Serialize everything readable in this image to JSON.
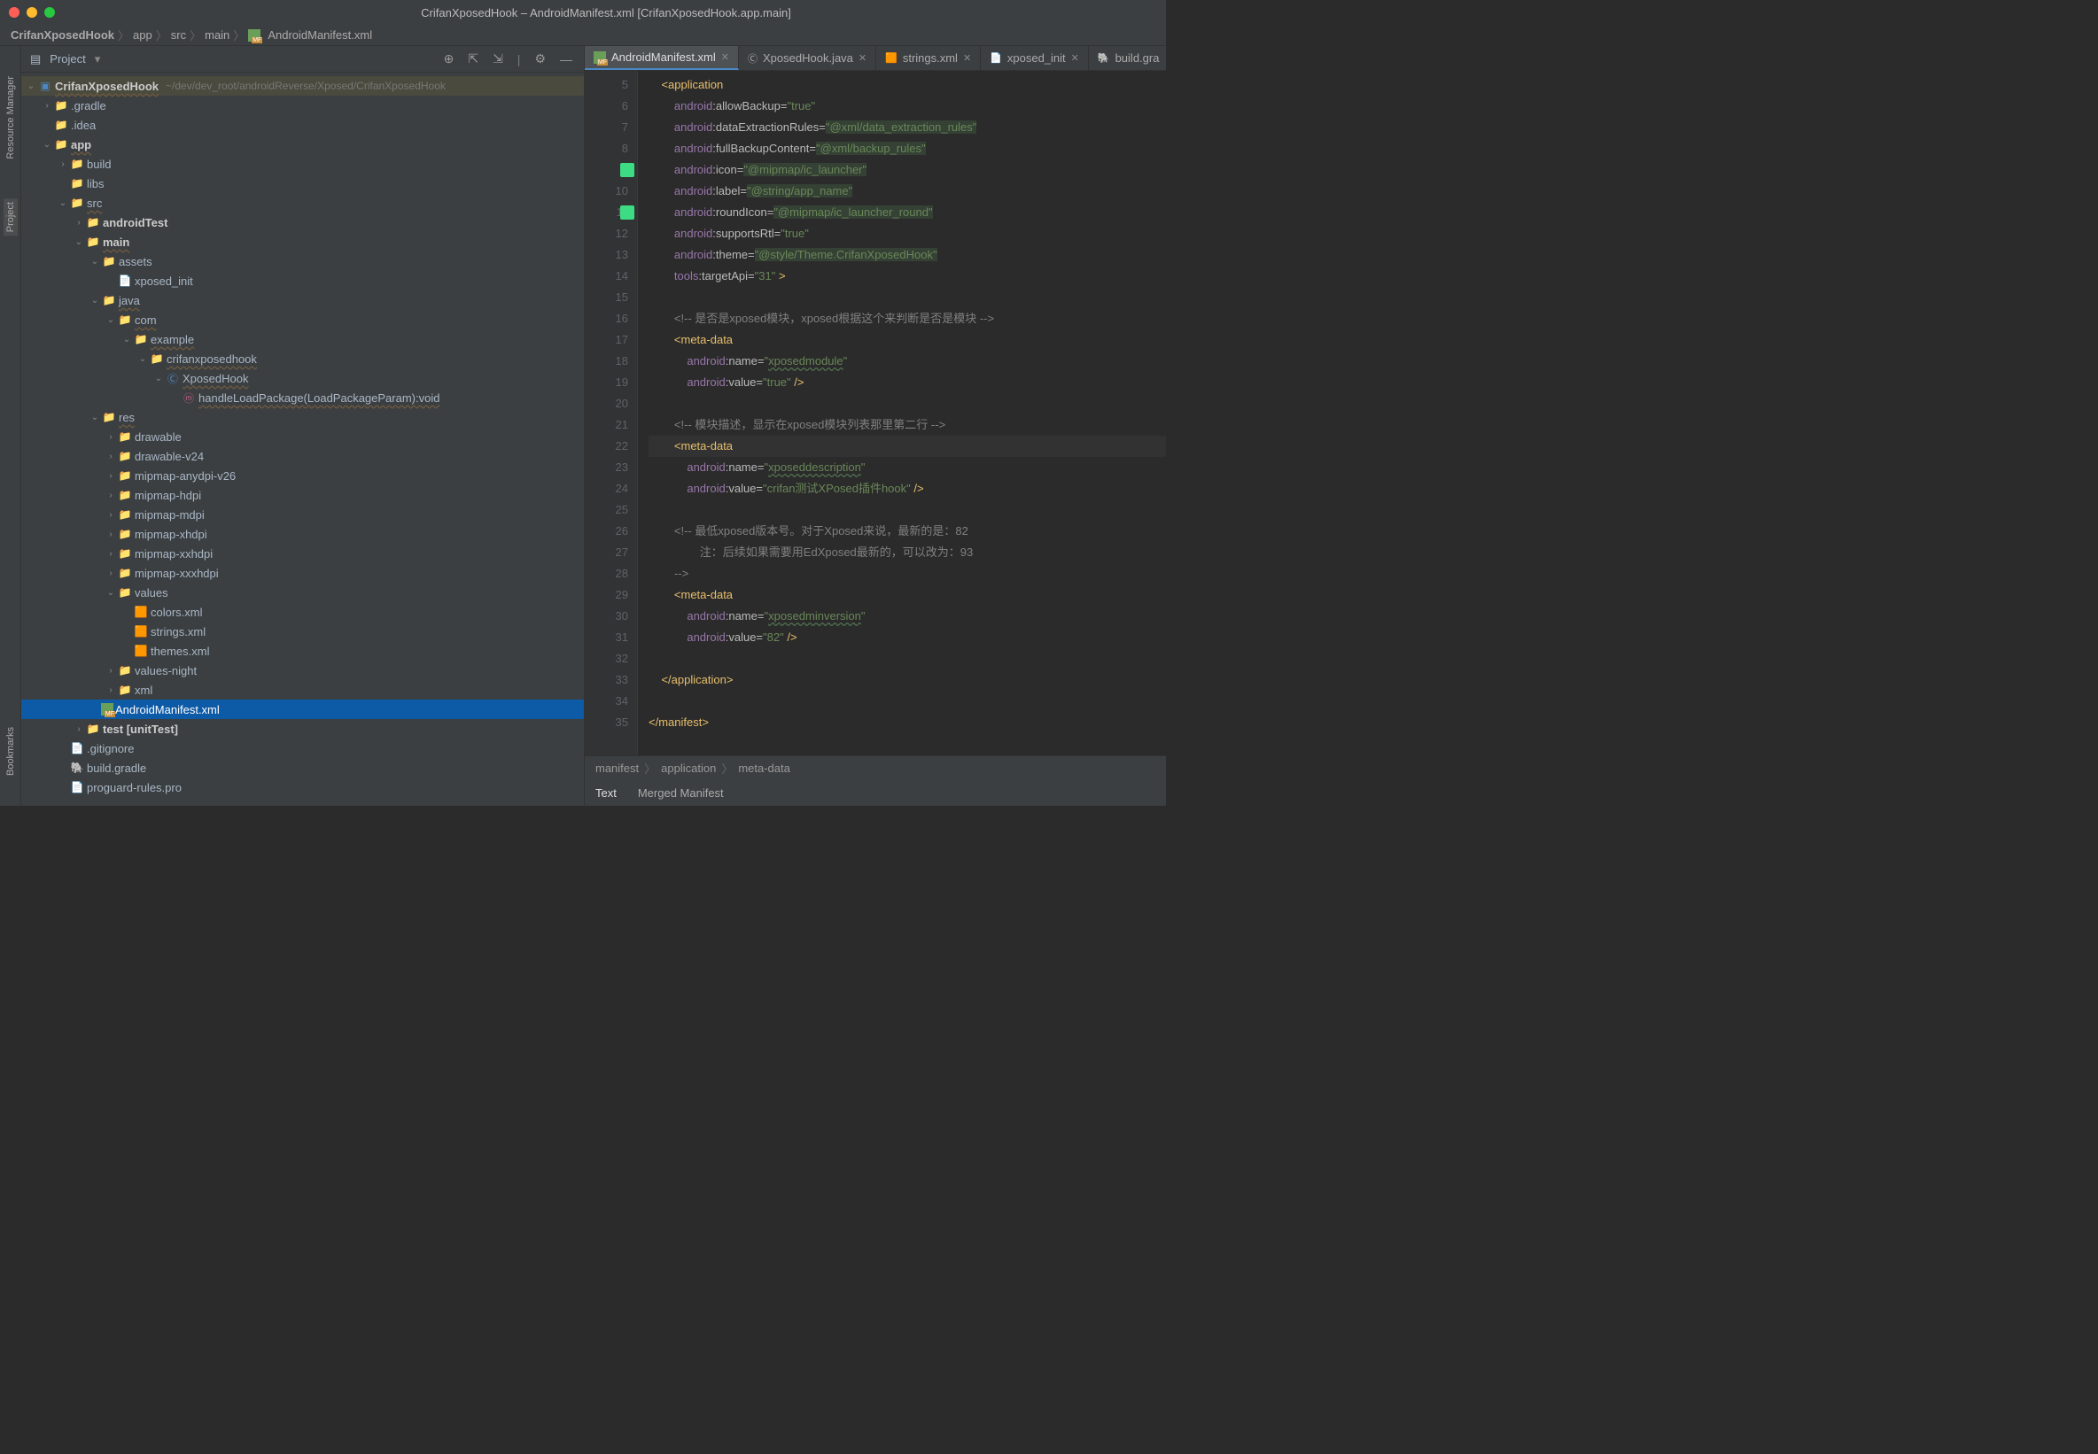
{
  "window": {
    "title": "CrifanXposedHook – AndroidManifest.xml [CrifanXposedHook.app.main]",
    "dots": [
      "#ff5f57",
      "#febc2e",
      "#28c840"
    ]
  },
  "breadcrumbs": [
    "CrifanXposedHook",
    "app",
    "src",
    "main",
    "AndroidManifest.xml"
  ],
  "sidebar": {
    "viewLabel": "Project",
    "leftTabs": [
      "Resource Manager",
      "Project"
    ],
    "leftBottomTab": "Bookmarks",
    "root": {
      "name": "CrifanXposedHook",
      "path": "~/dev/dev_root/androidReverse/Xposed/CrifanXposedHook"
    },
    "tree": [
      {
        "d": 1,
        "a": "r",
        "i": "📁",
        "c": "#c78f3a",
        "n": ".gradle"
      },
      {
        "d": 1,
        "a": "",
        "i": "📁",
        "c": "#888",
        "n": ".idea"
      },
      {
        "d": 1,
        "a": "d",
        "i": "📁",
        "c": "#6a9f5a",
        "n": "app",
        "b": 1,
        "u": 1
      },
      {
        "d": 2,
        "a": "r",
        "i": "📁",
        "c": "#c78f3a",
        "n": "build"
      },
      {
        "d": 2,
        "a": "",
        "i": "📁",
        "c": "#888",
        "n": "libs"
      },
      {
        "d": 2,
        "a": "d",
        "i": "📁",
        "c": "#4a88c7",
        "n": "src",
        "u": 1
      },
      {
        "d": 3,
        "a": "r",
        "i": "📁",
        "c": "#6a9f5a",
        "n": "androidTest",
        "b": 1
      },
      {
        "d": 3,
        "a": "d",
        "i": "📁",
        "c": "#6a9f5a",
        "n": "main",
        "b": 1,
        "u": 1
      },
      {
        "d": 4,
        "a": "d",
        "i": "📁",
        "c": "#aaa",
        "n": "assets"
      },
      {
        "d": 5,
        "a": "",
        "i": "📄",
        "c": "#aaa",
        "n": "xposed_init"
      },
      {
        "d": 4,
        "a": "d",
        "i": "📁",
        "c": "#4a88c7",
        "n": "java",
        "u": 1
      },
      {
        "d": 5,
        "a": "d",
        "i": "📁",
        "c": "#888",
        "n": "com",
        "u": 1
      },
      {
        "d": 6,
        "a": "d",
        "i": "📁",
        "c": "#888",
        "n": "example",
        "u": 1
      },
      {
        "d": 7,
        "a": "d",
        "i": "📁",
        "c": "#888",
        "n": "crifanxposedhook",
        "u": 1
      },
      {
        "d": 8,
        "a": "d",
        "i": "Ⓒ",
        "c": "#4a88c7",
        "n": "XposedHook",
        "u": 1
      },
      {
        "d": 9,
        "a": "",
        "i": "ⓜ",
        "c": "#b85c7c",
        "n": "handleLoadPackage(LoadPackageParam):void",
        "u": 1
      },
      {
        "d": 4,
        "a": "d",
        "i": "📁",
        "c": "#888",
        "n": "res",
        "u": 1
      },
      {
        "d": 5,
        "a": "r",
        "i": "📁",
        "c": "#888",
        "n": "drawable"
      },
      {
        "d": 5,
        "a": "r",
        "i": "📁",
        "c": "#888",
        "n": "drawable-v24"
      },
      {
        "d": 5,
        "a": "r",
        "i": "📁",
        "c": "#888",
        "n": "mipmap-anydpi-v26"
      },
      {
        "d": 5,
        "a": "r",
        "i": "📁",
        "c": "#888",
        "n": "mipmap-hdpi"
      },
      {
        "d": 5,
        "a": "r",
        "i": "📁",
        "c": "#888",
        "n": "mipmap-mdpi"
      },
      {
        "d": 5,
        "a": "r",
        "i": "📁",
        "c": "#888",
        "n": "mipmap-xhdpi"
      },
      {
        "d": 5,
        "a": "r",
        "i": "📁",
        "c": "#888",
        "n": "mipmap-xxhdpi"
      },
      {
        "d": 5,
        "a": "r",
        "i": "📁",
        "c": "#888",
        "n": "mipmap-xxxhdpi"
      },
      {
        "d": 5,
        "a": "d",
        "i": "📁",
        "c": "#888",
        "n": "values"
      },
      {
        "d": 6,
        "a": "",
        "i": "🟧",
        "c": "#c78f3a",
        "n": "colors.xml"
      },
      {
        "d": 6,
        "a": "",
        "i": "🟧",
        "c": "#c78f3a",
        "n": "strings.xml"
      },
      {
        "d": 6,
        "a": "",
        "i": "🟧",
        "c": "#c78f3a",
        "n": "themes.xml"
      },
      {
        "d": 5,
        "a": "r",
        "i": "📁",
        "c": "#888",
        "n": "values-night"
      },
      {
        "d": 5,
        "a": "r",
        "i": "📁",
        "c": "#888",
        "n": "xml"
      },
      {
        "d": 4,
        "a": "",
        "i": "MF",
        "c": "#6a9f5a",
        "n": "AndroidManifest.xml",
        "sel": 1
      },
      {
        "d": 3,
        "a": "r",
        "i": "📁",
        "c": "#6a9f5a",
        "n": "test [unitTest]",
        "b": 1
      },
      {
        "d": 2,
        "a": "",
        "i": "📄",
        "c": "#888",
        "n": ".gitignore"
      },
      {
        "d": 2,
        "a": "",
        "i": "🐘",
        "c": "#888",
        "n": "build.gradle"
      },
      {
        "d": 2,
        "a": "",
        "i": "📄",
        "c": "#888",
        "n": "proguard-rules.pro"
      }
    ]
  },
  "tabs": [
    {
      "icon": "MF",
      "label": "AndroidManifest.xml",
      "active": true
    },
    {
      "icon": "Ⓒ",
      "label": "XposedHook.java"
    },
    {
      "icon": "🟧",
      "label": "strings.xml"
    },
    {
      "icon": "📄",
      "label": "xposed_init"
    },
    {
      "icon": "🐘",
      "label": "build.gra"
    }
  ],
  "editor": {
    "startLine": 5,
    "gutterIcons": {
      "9": true,
      "11": true
    },
    "highlightLine": 22,
    "lines": [
      {
        "ind": 1,
        "seg": [
          {
            "t": "<application",
            "c": "tag"
          }
        ]
      },
      {
        "ind": 2,
        "seg": [
          {
            "t": "android",
            "c": "attr"
          },
          {
            "t": ":",
            "c": "ns"
          },
          {
            "t": "allowBackup",
            "c": "ns"
          },
          {
            "t": "=",
            "c": "ns"
          },
          {
            "t": "\"true\"",
            "c": "str"
          }
        ]
      },
      {
        "ind": 2,
        "seg": [
          {
            "t": "android",
            "c": "attr"
          },
          {
            "t": ":",
            "c": "ns"
          },
          {
            "t": "dataExtractionRules",
            "c": "ns"
          },
          {
            "t": "=",
            "c": "ns"
          },
          {
            "t": "\"@xml/data_extraction_rules\"",
            "c": "strh"
          }
        ]
      },
      {
        "ind": 2,
        "seg": [
          {
            "t": "android",
            "c": "attr"
          },
          {
            "t": ":",
            "c": "ns"
          },
          {
            "t": "fullBackupContent",
            "c": "ns"
          },
          {
            "t": "=",
            "c": "ns"
          },
          {
            "t": "\"@xml/backup_rules\"",
            "c": "strh"
          }
        ]
      },
      {
        "ind": 2,
        "seg": [
          {
            "t": "android",
            "c": "attr"
          },
          {
            "t": ":",
            "c": "ns"
          },
          {
            "t": "icon",
            "c": "ns"
          },
          {
            "t": "=",
            "c": "ns"
          },
          {
            "t": "\"@mipmap/ic_launcher\"",
            "c": "strh"
          }
        ]
      },
      {
        "ind": 2,
        "seg": [
          {
            "t": "android",
            "c": "attr"
          },
          {
            "t": ":",
            "c": "ns"
          },
          {
            "t": "label",
            "c": "ns"
          },
          {
            "t": "=",
            "c": "ns"
          },
          {
            "t": "\"@string/app_name\"",
            "c": "strh"
          }
        ]
      },
      {
        "ind": 2,
        "seg": [
          {
            "t": "android",
            "c": "attr"
          },
          {
            "t": ":",
            "c": "ns"
          },
          {
            "t": "roundIcon",
            "c": "ns"
          },
          {
            "t": "=",
            "c": "ns"
          },
          {
            "t": "\"@mipmap/ic_launcher_round\"",
            "c": "strh"
          }
        ]
      },
      {
        "ind": 2,
        "seg": [
          {
            "t": "android",
            "c": "attr"
          },
          {
            "t": ":",
            "c": "ns"
          },
          {
            "t": "supportsRtl",
            "c": "ns"
          },
          {
            "t": "=",
            "c": "ns"
          },
          {
            "t": "\"true\"",
            "c": "str"
          }
        ]
      },
      {
        "ind": 2,
        "seg": [
          {
            "t": "android",
            "c": "attr"
          },
          {
            "t": ":",
            "c": "ns"
          },
          {
            "t": "theme",
            "c": "ns"
          },
          {
            "t": "=",
            "c": "ns"
          },
          {
            "t": "\"@style/Theme.CrifanXposedHook\"",
            "c": "strh"
          }
        ]
      },
      {
        "ind": 2,
        "seg": [
          {
            "t": "tools",
            "c": "attr"
          },
          {
            "t": ":",
            "c": "ns"
          },
          {
            "t": "targetApi",
            "c": "ns"
          },
          {
            "t": "=",
            "c": "ns"
          },
          {
            "t": "\"31\" ",
            "c": "str"
          },
          {
            "t": ">",
            "c": "tag"
          }
        ]
      },
      {
        "ind": 0,
        "seg": []
      },
      {
        "ind": 2,
        "seg": [
          {
            "t": "<!-- 是否是xposed模块，xposed根据这个来判断是否是模块 -->",
            "c": "cmt"
          }
        ]
      },
      {
        "ind": 2,
        "seg": [
          {
            "t": "<meta-data",
            "c": "tag"
          }
        ]
      },
      {
        "ind": 3,
        "seg": [
          {
            "t": "android",
            "c": "attr"
          },
          {
            "t": ":",
            "c": "ns"
          },
          {
            "t": "name",
            "c": "ns"
          },
          {
            "t": "=",
            "c": "ns"
          },
          {
            "t": "\"",
            "c": "str"
          },
          {
            "t": "xposedmodule",
            "c": "str ulg"
          },
          {
            "t": "\"",
            "c": "str"
          }
        ]
      },
      {
        "ind": 3,
        "seg": [
          {
            "t": "android",
            "c": "attr"
          },
          {
            "t": ":",
            "c": "ns"
          },
          {
            "t": "value",
            "c": "ns"
          },
          {
            "t": "=",
            "c": "ns"
          },
          {
            "t": "\"true\" ",
            "c": "str"
          },
          {
            "t": "/>",
            "c": "tag"
          }
        ]
      },
      {
        "ind": 0,
        "seg": []
      },
      {
        "ind": 2,
        "seg": [
          {
            "t": "<!-- 模块描述，显示在xposed模块列表那里第二行 -->",
            "c": "cmt"
          }
        ]
      },
      {
        "ind": 2,
        "seg": [
          {
            "t": "<meta-data",
            "c": "tag"
          }
        ]
      },
      {
        "ind": 3,
        "seg": [
          {
            "t": "android",
            "c": "attr"
          },
          {
            "t": ":",
            "c": "ns"
          },
          {
            "t": "name",
            "c": "ns"
          },
          {
            "t": "=",
            "c": "ns"
          },
          {
            "t": "\"",
            "c": "str"
          },
          {
            "t": "xposeddescription",
            "c": "str ulg"
          },
          {
            "t": "\"",
            "c": "str"
          }
        ]
      },
      {
        "ind": 3,
        "seg": [
          {
            "t": "android",
            "c": "attr"
          },
          {
            "t": ":",
            "c": "ns"
          },
          {
            "t": "value",
            "c": "ns"
          },
          {
            "t": "=",
            "c": "ns"
          },
          {
            "t": "\"crifan测试XPosed插件hook\" ",
            "c": "str"
          },
          {
            "t": "/>",
            "c": "tag"
          }
        ]
      },
      {
        "ind": 0,
        "seg": []
      },
      {
        "ind": 2,
        "seg": [
          {
            "t": "<!-- 最低xposed版本号。对于Xposed来说，最新的是：82",
            "c": "cmt"
          }
        ]
      },
      {
        "ind": 3,
        "seg": [
          {
            "t": "    注：后续如果需要用EdXposed最新的，可以改为：93",
            "c": "cmt"
          }
        ]
      },
      {
        "ind": 2,
        "seg": [
          {
            "t": "-->",
            "c": "cmt"
          }
        ]
      },
      {
        "ind": 2,
        "seg": [
          {
            "t": "<meta-data",
            "c": "tag"
          }
        ]
      },
      {
        "ind": 3,
        "seg": [
          {
            "t": "android",
            "c": "attr"
          },
          {
            "t": ":",
            "c": "ns"
          },
          {
            "t": "name",
            "c": "ns"
          },
          {
            "t": "=",
            "c": "ns"
          },
          {
            "t": "\"",
            "c": "str"
          },
          {
            "t": "xposedminversion",
            "c": "str ulg"
          },
          {
            "t": "\"",
            "c": "str"
          }
        ]
      },
      {
        "ind": 3,
        "seg": [
          {
            "t": "android",
            "c": "attr"
          },
          {
            "t": ":",
            "c": "ns"
          },
          {
            "t": "value",
            "c": "ns"
          },
          {
            "t": "=",
            "c": "ns"
          },
          {
            "t": "\"82\" ",
            "c": "str"
          },
          {
            "t": "/>",
            "c": "tag"
          }
        ]
      },
      {
        "ind": 0,
        "seg": []
      },
      {
        "ind": 1,
        "seg": [
          {
            "t": "</application>",
            "c": "tag"
          }
        ]
      },
      {
        "ind": 0,
        "seg": []
      },
      {
        "ind": 0,
        "seg": [
          {
            "t": "</manifest>",
            "c": "tag"
          }
        ]
      }
    ]
  },
  "bottom": {
    "crumbs": [
      "manifest",
      "application",
      "meta-data"
    ],
    "tabs": [
      "Text",
      "Merged Manifest"
    ],
    "active": 0
  }
}
